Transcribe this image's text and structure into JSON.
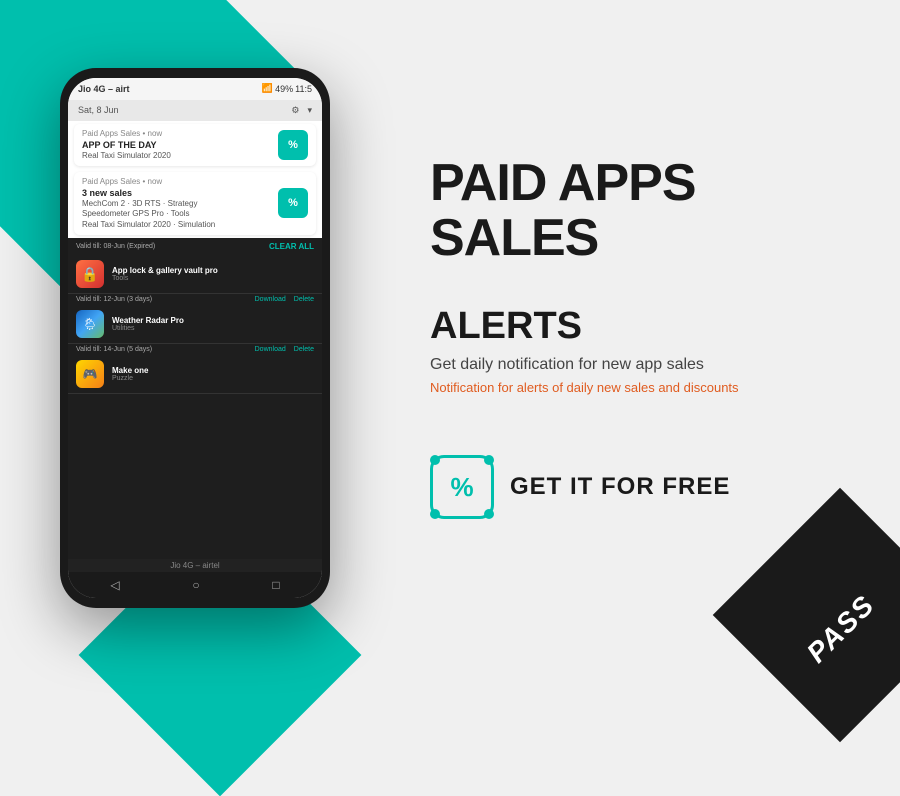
{
  "background_color": "#f0f0f0",
  "accent_color": "#00bfad",
  "page": {
    "title": "PAID APPS SALES",
    "badge": "PASS"
  },
  "right_panel": {
    "main_title": "PAID APPS SALES",
    "alerts_title": "ALERTS",
    "alerts_subtitle": "Get daily notification for new app sales",
    "alerts_desc": "Notification for alerts of daily new sales and discounts",
    "get_free_label": "GET IT FOR FREE"
  },
  "phone": {
    "carrier": "Jio 4G – airt",
    "battery": "49%",
    "time": "11:5",
    "carrier_bottom": "Jio 4G – airtel",
    "date_header": "Sat, 8 Jun",
    "notification1": {
      "sender": "Paid Apps Sales • now",
      "title": "APP OF THE DAY",
      "body": "Real Taxi Simulator 2020"
    },
    "notification2": {
      "sender": "Paid Apps Sales • now",
      "title": "3 new sales",
      "body1": "MechCom 2 · 3D RTS · Strategy",
      "body2": "Speedometer GPS Pro · Tools",
      "body3": "Real Taxi Simulator 2020 · Simulation"
    },
    "dark_section": {
      "header1": "Valid till: 08-Jun (Expired)",
      "clear_all": "CLEAR ALL",
      "app1_name": "App lock & gallery vault pro",
      "app1_category": "Tools",
      "app2_valid": "Valid till: 12-Jun (3 days)",
      "app2_name": "Weather Radar Pro",
      "app2_category": "Utilities",
      "app3_valid": "Valid till: 14-Jun (5 days)",
      "app3_name": "Make one",
      "app3_category": "Puzzle",
      "download_label": "Download",
      "delete_label": "Delete"
    }
  }
}
